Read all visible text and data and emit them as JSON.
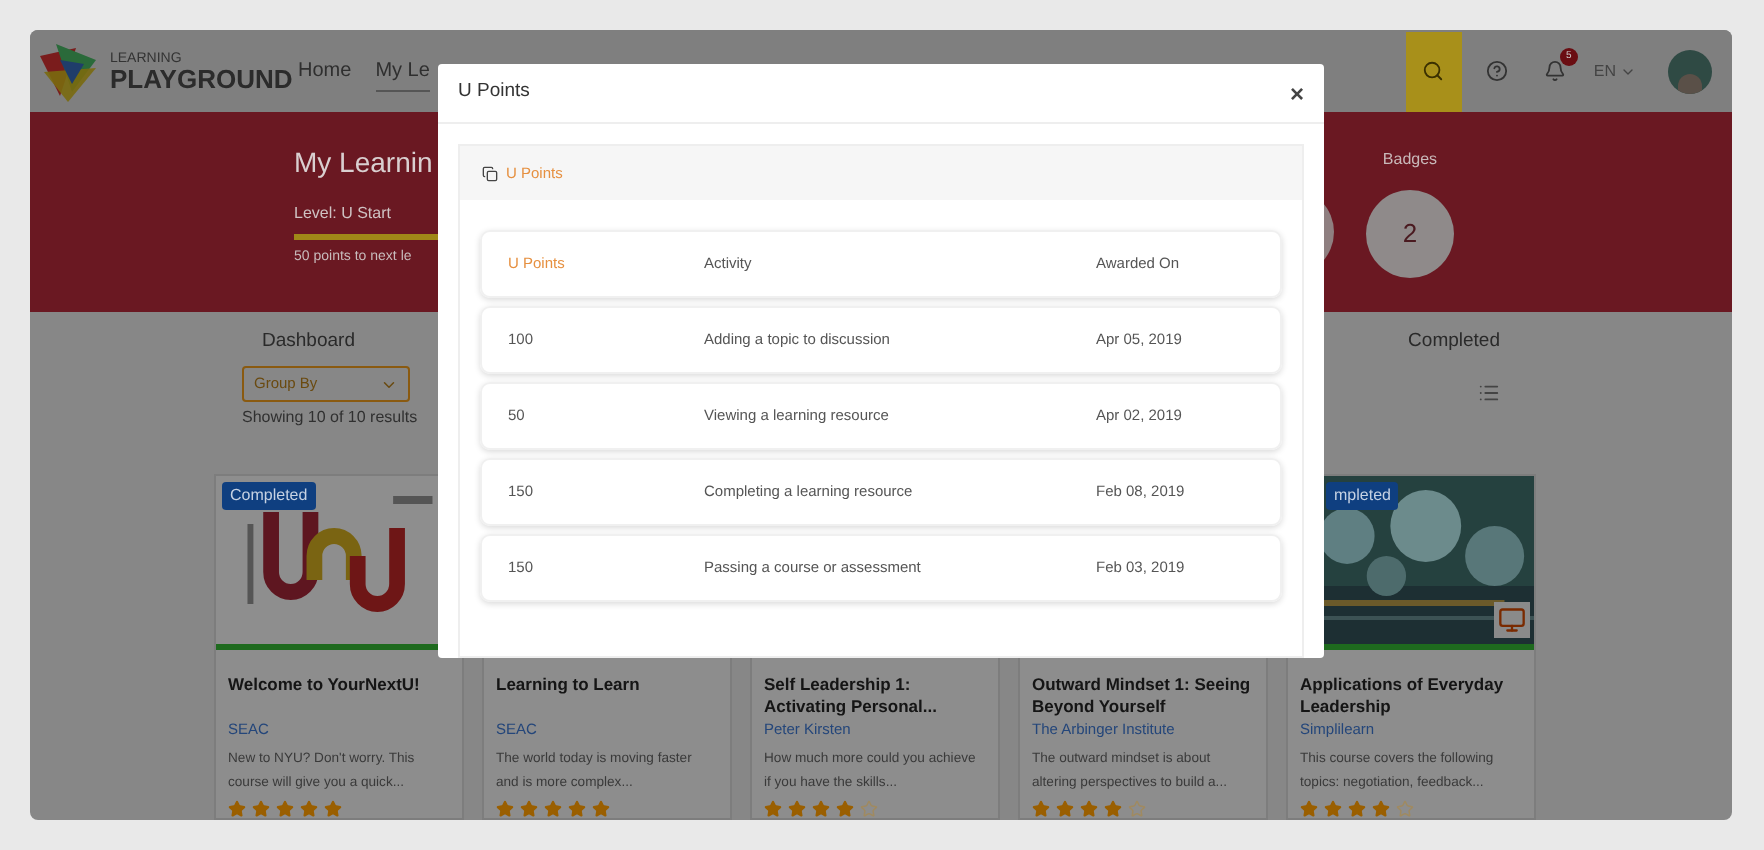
{
  "header": {
    "logo": {
      "line_1": "LEARNING",
      "line_2": "PLAYGROUND"
    },
    "nav": [
      {
        "label": "Home",
        "selected": false
      },
      {
        "label": "My Le",
        "selected": true
      }
    ],
    "notifications_count": "5",
    "language": "EN"
  },
  "hero": {
    "title": "My Learnin",
    "level": "Level: U Start",
    "progress": {
      "level": 1
    },
    "next_level": "50 points to next le",
    "badges": {
      "label": "Badges",
      "value": "2"
    }
  },
  "tabs": [
    {
      "label": "Dashboard"
    },
    {
      "label": "Completed"
    }
  ],
  "filter": {
    "group_by": "Group By",
    "results": "Showing 10 of 10 results"
  },
  "cards": [
    {
      "kind": "picture",
      "badge": "Completed",
      "title": "Welcome to YourNextU!",
      "provider": "SEAC",
      "description": "New to NYU? Don't worry. This course will give you a quick...",
      "stars": 5
    },
    {
      "title": "Learning to Learn",
      "provider": "SEAC",
      "description": "The world today is moving faster and is more complex...",
      "stars": 5
    },
    {
      "title": "Self Leadership 1: Activating Personal...",
      "provider": "Peter Kirsten",
      "description": "How much more could you achieve if you have the skills...",
      "stars": 4
    },
    {
      "title": "Outward Mindset 1: Seeing Beyond Yourself",
      "provider": "The Arbinger Institute",
      "description": "The outward mindset is about altering perspectives to build a...",
      "stars": 4
    },
    {
      "kind": "picture",
      "badge": "mpleted",
      "title": "Applications of Everyday Leadership",
      "provider": "Simplilearn",
      "description": "This course covers the following topics: negotiation, feedback...",
      "stars": 4
    }
  ],
  "modal": {
    "title": "U Points",
    "close": "×",
    "panel_title": "U Points",
    "columns": [
      "U Points",
      "Activity",
      "Awarded On"
    ],
    "rows": [
      [
        "100",
        "Adding a topic to discussion",
        "Apr 05, 2019"
      ],
      [
        "50",
        "Viewing a learning resource",
        "Apr 02, 2019"
      ],
      [
        "150",
        "Completing a learning resource",
        "Feb 08, 2019"
      ],
      [
        "150",
        "Passing a course or assessment",
        "Feb 03, 2019"
      ]
    ]
  }
}
